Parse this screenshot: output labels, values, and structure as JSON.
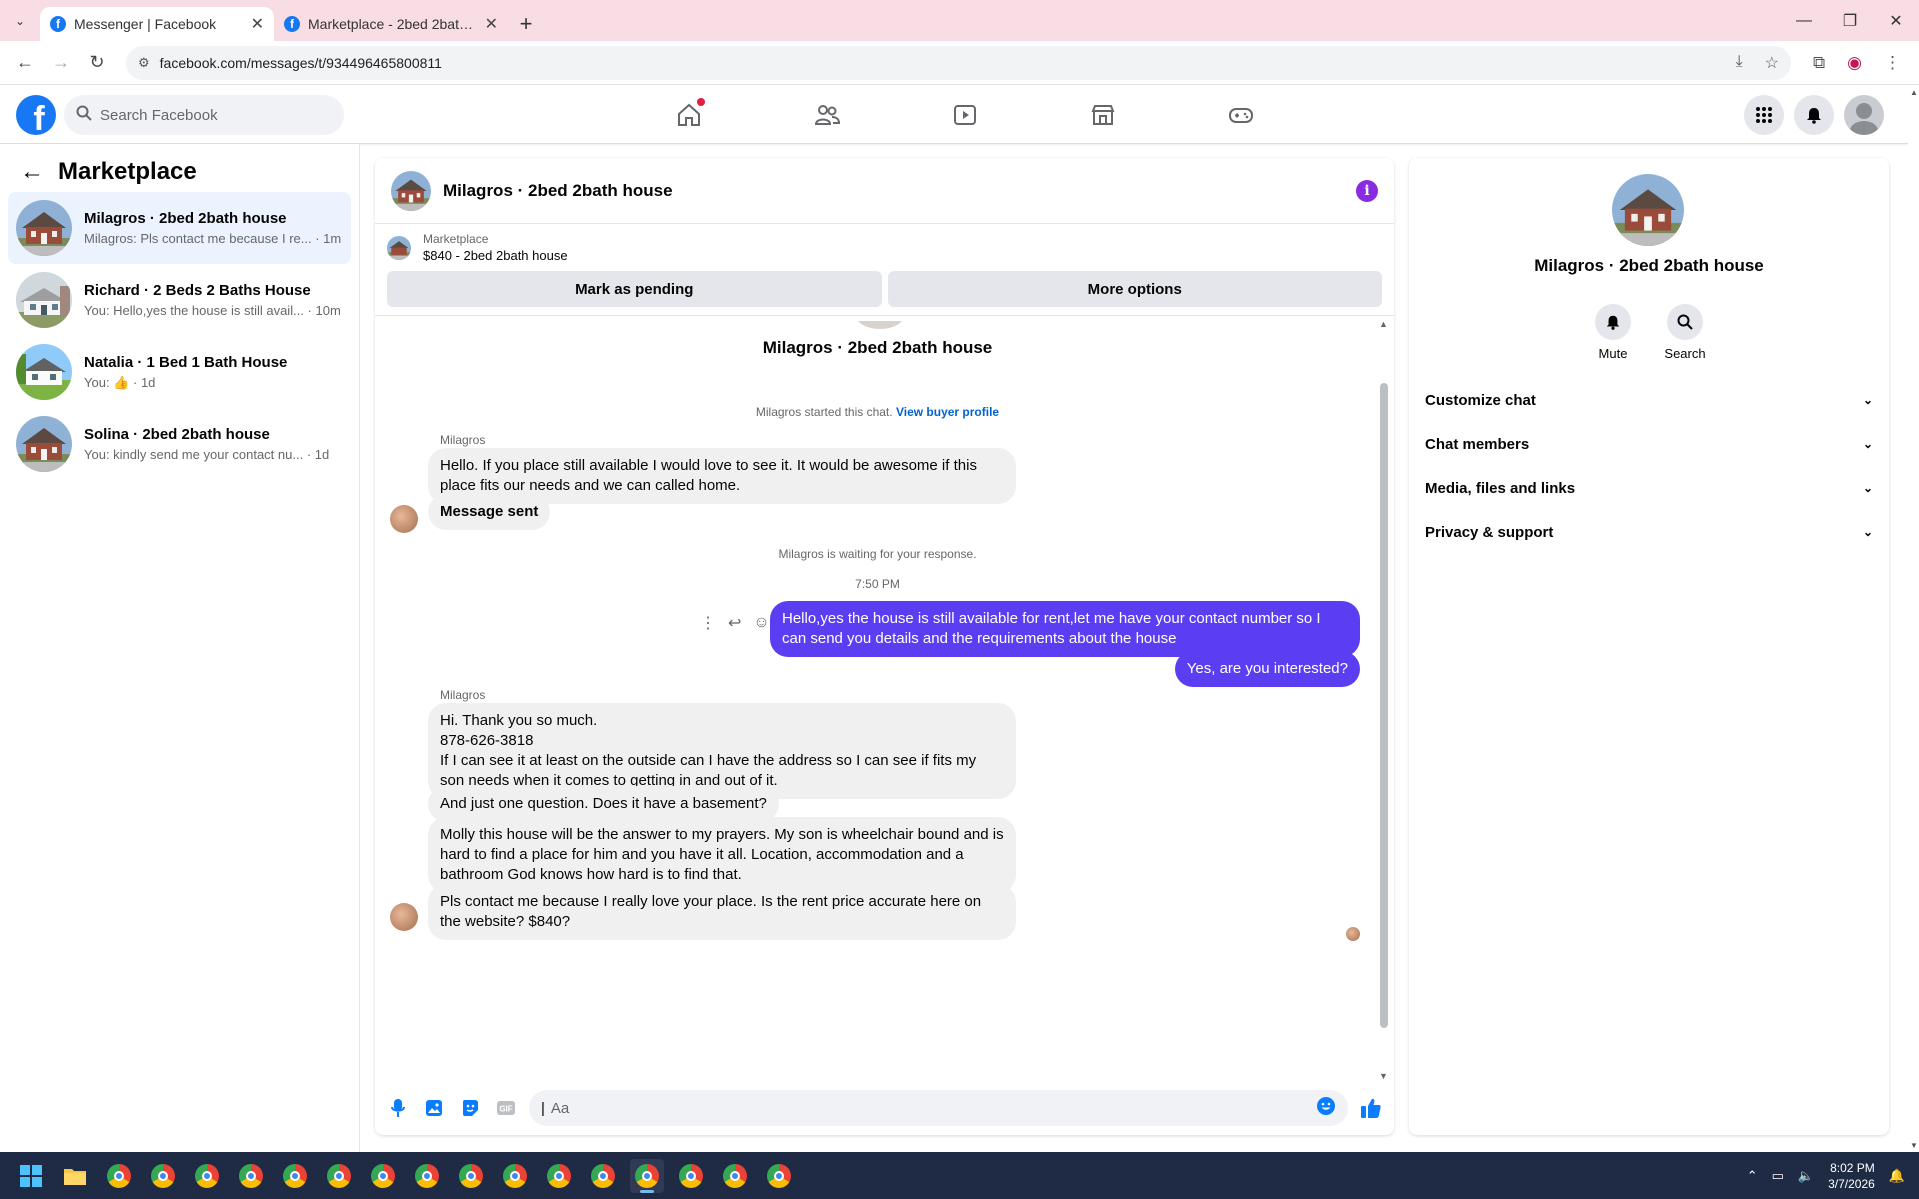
{
  "browser": {
    "tabs": [
      {
        "title": "Messenger | Facebook",
        "active": true
      },
      {
        "title": "Marketplace - 2bed 2bath hous",
        "active": false
      }
    ],
    "url": "facebook.com/messages/t/934496465800811"
  },
  "fb": {
    "search_placeholder": "Search Facebook"
  },
  "left": {
    "title": "Marketplace",
    "conversations": [
      {
        "name": "Milagros · 2bed 2bath house",
        "preview": "Milagros: Pls contact me because I re...",
        "time": "· 1m"
      },
      {
        "name": "Richard · 2 Beds 2 Baths House",
        "preview": "You: Hello,yes the house is still avail...",
        "time": "· 10m"
      },
      {
        "name": "Natalia · 1 Bed 1 Bath House",
        "preview": "You:",
        "time": "· 1d"
      },
      {
        "name": "Solina · 2bed 2bath house",
        "preview": "You: kindly send me your contact nu...",
        "time": "· 1d"
      }
    ]
  },
  "chat": {
    "title": "Milagros · 2bed 2bath house",
    "listing_label": "Marketplace",
    "listing_price": "$840 - 2bed 2bath house",
    "btn_pending": "Mark as pending",
    "btn_more": "More options",
    "center_title": "Milagros · 2bed 2bath house",
    "started_text": "Milagros started this chat.",
    "view_profile": "View buyer profile",
    "sender1": "Milagros",
    "msg1": "Hello. If you place still available I would love to see it. It would be awesome if this place fits our needs and we can called home.",
    "msg2": "Message sent",
    "waiting": "Milagros is waiting for your response.",
    "time": "7:50 PM",
    "out1": "Hello,yes the house is still available for rent,let me have your contact number so I can send you details and the requirements about the house",
    "out2": "Yes, are you interested?",
    "sender2": "Milagros",
    "msg3_l1": "Hi. Thank you so much.",
    "msg3_l2": "878-626-3818",
    "msg3_l3": "If I can see it at least on the outside can I have the address so I can see if fits my son needs when it comes to getting in and out of it.",
    "msg4": "And just one question. Does it have a basement?",
    "msg5": "Molly this house will be the answer to my prayers. My son is wheelchair bound and is hard to find a place for him and you have it all. Location, accommodation and a bathroom God knows how hard is to find that.",
    "msg6": "Pls contact me because I really love your place. Is the rent price accurate here on the website? $840?",
    "composer_placeholder": "Aa"
  },
  "right": {
    "name": "Milagros · 2bed 2bath house",
    "mute": "Mute",
    "search": "Search",
    "items": [
      "Customize chat",
      "Chat members",
      "Media, files and links",
      "Privacy & support"
    ]
  },
  "taskbar": {
    "time": "8:02 PM",
    "date": "3/7/2026"
  },
  "colors": {
    "messenger_purple": "#5b3ef2",
    "fb_blue": "#1877f2"
  }
}
